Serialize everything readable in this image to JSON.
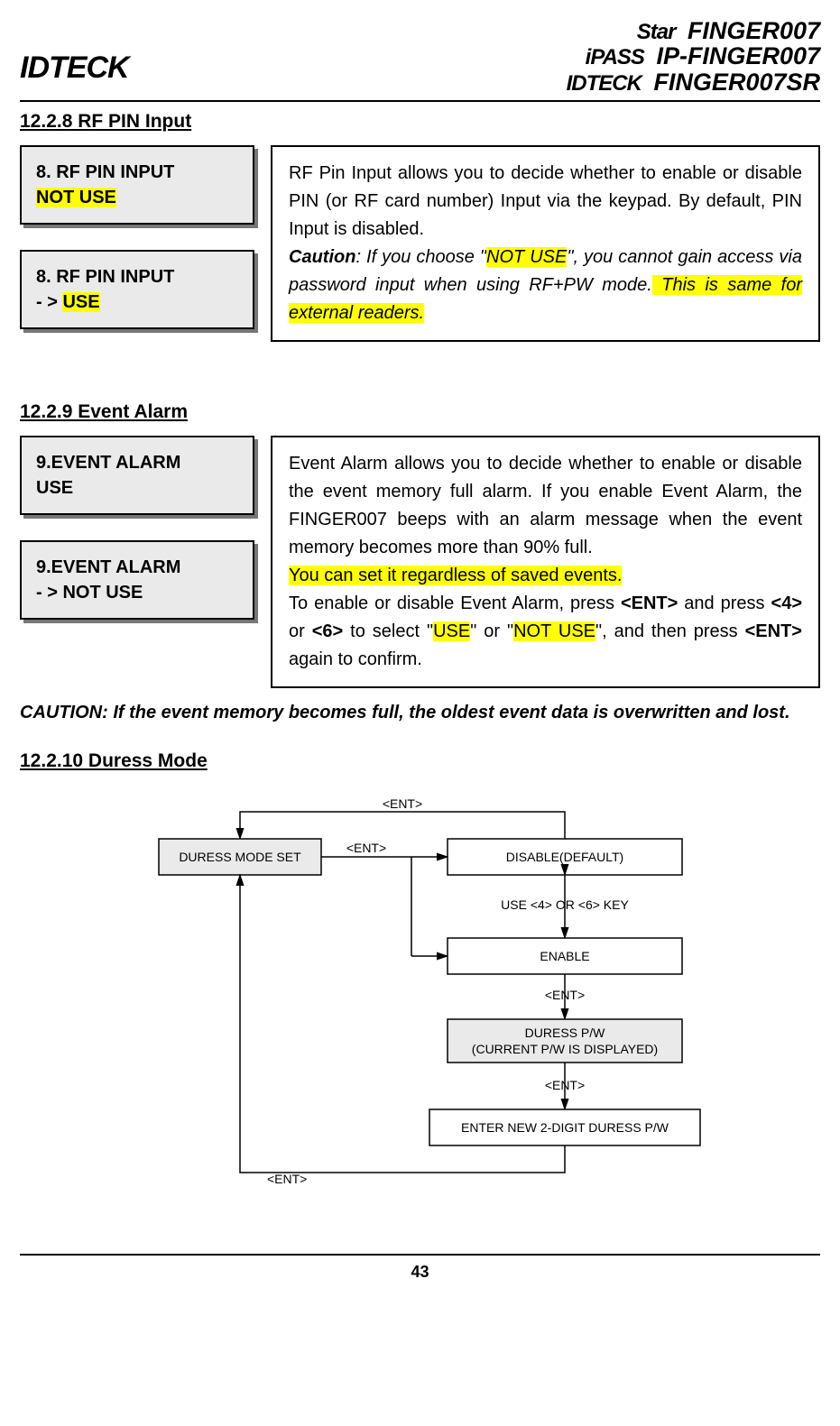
{
  "header": {
    "left_logo": "IDTECK",
    "right": {
      "line1_prefix": "Star",
      "line1_model": "FINGER007",
      "line2_prefix": "iPASS",
      "line2_model": "IP-FINGER007",
      "line3_prefix": "IDTECK",
      "line3_model": "FINGER007SR"
    }
  },
  "section_1228": {
    "heading": "12.2.8 RF PIN Input",
    "lcd1_line1": "8. RF PIN INPUT",
    "lcd1_line2": "NOT USE",
    "lcd2_line1": "8. RF PIN INPUT",
    "lcd2_line2_prefix": "- > ",
    "lcd2_line2_hl": "USE",
    "desc_pre": "RF Pin Input allows you to decide whether to enable or disable PIN (or RF card number) Input via the keypad. By default, PIN Input is disabled.",
    "caution_label": "Caution",
    "caution_mid1": ": If you choose \"",
    "caution_hl1": "NOT USE",
    "caution_mid2": "\", you cannot gain access via password input when using RF+PW mode.",
    "caution_hl2": " This is same for external readers."
  },
  "section_1229": {
    "heading": "12.2.9 Event Alarm",
    "lcd1_line1": "9.EVENT ALARM",
    "lcd1_line2": "USE",
    "lcd2_line1": "9.EVENT ALARM",
    "lcd2_line2": "- > NOT USE",
    "desc_p1": "Event Alarm allows you to decide whether to enable or disable the event memory full alarm. If you enable Event Alarm, the FINGER007 beeps with an alarm message when the event memory becomes more than 90% full.",
    "desc_hl": "You can set it regardless of saved events.",
    "desc_p2_pre": "To enable or disable Event Alarm, press ",
    "desc_ent": "<ENT>",
    "desc_p2_mid1": " and press ",
    "desc_4": "<4>",
    "desc_or": " or ",
    "desc_6": "<6>",
    "desc_p2_mid2": " to select \"",
    "desc_use": "USE",
    "desc_p2_mid3": "\" or \"",
    "desc_notuse": "NOT USE",
    "desc_p2_mid4": "\", and then press ",
    "desc_p2_end": " again to confirm.",
    "caution_line": "CAUTION: If the event memory becomes full, the oldest event data is overwritten and lost."
  },
  "section_12210": {
    "heading": "12.2.10 Duress Mode"
  },
  "chart_data": {
    "type": "diagram",
    "description": "Flowchart for Duress Mode setting",
    "nodes": [
      {
        "id": "duress_mode_set",
        "label": "DURESS MODE SET",
        "shaded": true
      },
      {
        "id": "disable",
        "label": "DISABLE(DEFAULT)",
        "shaded": false
      },
      {
        "id": "enable",
        "label": "ENABLE",
        "shaded": false
      },
      {
        "id": "duress_pw",
        "label": "DURESS  P/W\n(CURRENT P/W IS DISPLAYED)",
        "shaded": true
      },
      {
        "id": "enter_pw",
        "label": "ENTER NEW 2-DIGIT DURESS P/W",
        "shaded": false
      }
    ],
    "edges": [
      {
        "from": "duress_mode_set",
        "to": "disable",
        "label": "<ENT>"
      },
      {
        "from": "duress_mode_set",
        "to": "enable",
        "label": ""
      },
      {
        "from": "disable",
        "to": "enable",
        "label": "USE <4> OR <6> KEY",
        "bidirectional": true
      },
      {
        "from": "enable",
        "to": "duress_pw",
        "label": "<ENT>"
      },
      {
        "from": "duress_pw",
        "to": "enter_pw",
        "label": "<ENT>"
      },
      {
        "from": "disable",
        "to": "duress_mode_set",
        "label": "<ENT>",
        "loop_back_top": true
      },
      {
        "from": "enter_pw",
        "to": "duress_mode_set",
        "label": "<ENT>",
        "loop_back_bottom": true
      }
    ]
  },
  "footer": {
    "page_number": "43"
  }
}
